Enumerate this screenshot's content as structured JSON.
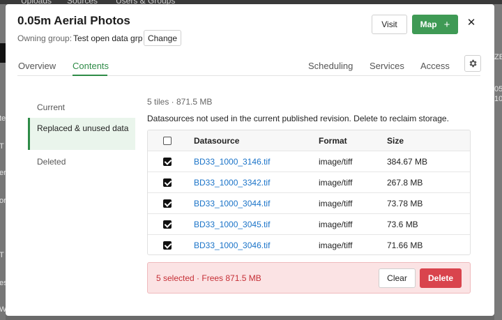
{
  "background": {
    "top_items": [
      "Uploads",
      "Sources",
      "Users & Groups"
    ],
    "left_fragments": [
      "te",
      "T",
      "er",
      "or",
      "T",
      "es",
      "W"
    ],
    "right_fragments": [
      "ZE",
      "05",
      "10"
    ]
  },
  "modal": {
    "title": "0.05m Aerial Photos",
    "owning_label": "Owning group:",
    "owning_value": "Test open data grp",
    "change_label": "Change",
    "visit_label": "Visit",
    "map_label": "Map",
    "close_glyph": "✕"
  },
  "tabs": {
    "overview": "Overview",
    "contents": "Contents",
    "scheduling": "Scheduling",
    "services": "Services",
    "access": "Access"
  },
  "sidenav": {
    "current": "Current",
    "replaced": "Replaced & unused data",
    "deleted": "Deleted"
  },
  "content": {
    "summary": "5 tiles · 871.5 MB",
    "description": "Datasources not used in the current published revision. Delete to reclaim storage."
  },
  "table": {
    "headers": {
      "datasource": "Datasource",
      "format": "Format",
      "size": "Size"
    },
    "rows": [
      {
        "datasource": "BD33_1000_3146.tif",
        "format": "image/tiff",
        "size": "384.67 MB",
        "checked": true
      },
      {
        "datasource": "BD33_1000_3342.tif",
        "format": "image/tiff",
        "size": "267.8 MB",
        "checked": true
      },
      {
        "datasource": "BD33_1000_3044.tif",
        "format": "image/tiff",
        "size": "73.78 MB",
        "checked": true
      },
      {
        "datasource": "BD33_1000_3045.tif",
        "format": "image/tiff",
        "size": "73.6 MB",
        "checked": true
      },
      {
        "datasource": "BD33_1000_3046.tif",
        "format": "image/tiff",
        "size": "71.66 MB",
        "checked": true
      }
    ]
  },
  "selection": {
    "text": "5 selected · Frees 871.5 MB",
    "clear_label": "Clear",
    "delete_label": "Delete"
  },
  "colors": {
    "accent": "#2e8b47",
    "primary_button": "#3f9a55",
    "danger": "#d9444d",
    "link": "#1a73c8",
    "selection_bg": "#fbe3e4"
  }
}
